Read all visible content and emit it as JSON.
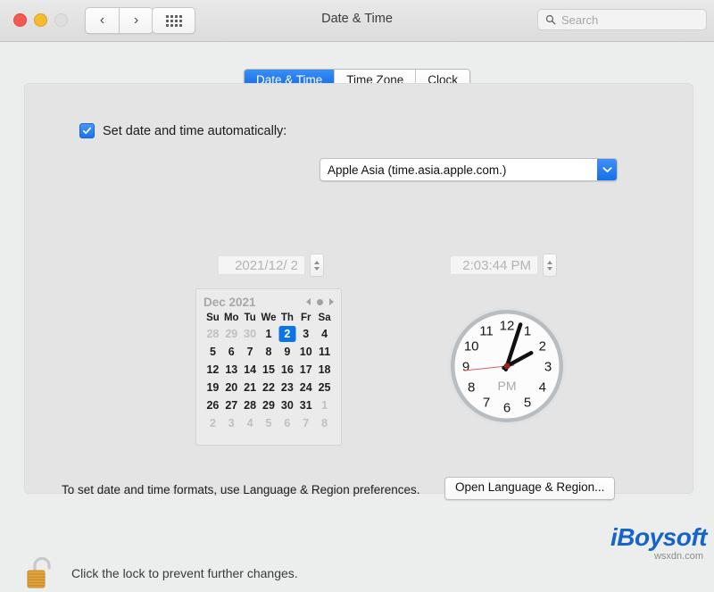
{
  "window": {
    "title": "Date & Time",
    "traffic_lights": [
      "close",
      "minimize",
      "zoom"
    ],
    "back_icon": "chevron-left-icon",
    "forward_icon": "chevron-right-icon",
    "grid_icon": "grid-dots-icon"
  },
  "search": {
    "placeholder": "Search",
    "value": "",
    "icon": "search-icon"
  },
  "tabs": [
    {
      "label": "Date & Time",
      "active": true
    },
    {
      "label": "Time Zone",
      "active": false
    },
    {
      "label": "Clock",
      "active": false
    }
  ],
  "auto_row": {
    "checkbox_checked": true,
    "checkbox_icon": "checkmark-icon",
    "label": "Set date and time automatically:",
    "server_value": "Apple Asia (time.asia.apple.com.)",
    "dropdown_icon": "chevron-down-icon"
  },
  "date_field": {
    "value": "2021/12/ 2",
    "stepper_icon": "stepper-updown-icon"
  },
  "time_field": {
    "value": "2:03:44 PM",
    "stepper_icon": "stepper-updown-icon"
  },
  "calendar": {
    "month_label": "Dec 2021",
    "prev_icon": "triangle-left-icon",
    "today_icon": "dot-icon",
    "next_icon": "triangle-right-icon",
    "day_headers": [
      "Su",
      "Mo",
      "Tu",
      "We",
      "Th",
      "Fr",
      "Sa"
    ],
    "weeks": [
      [
        {
          "d": "28",
          "muted": true
        },
        {
          "d": "29",
          "muted": true
        },
        {
          "d": "30",
          "muted": true
        },
        {
          "d": "1"
        },
        {
          "d": "2",
          "selected": true
        },
        {
          "d": "3"
        },
        {
          "d": "4"
        }
      ],
      [
        {
          "d": "5"
        },
        {
          "d": "6"
        },
        {
          "d": "7"
        },
        {
          "d": "8"
        },
        {
          "d": "9"
        },
        {
          "d": "10"
        },
        {
          "d": "11"
        }
      ],
      [
        {
          "d": "12"
        },
        {
          "d": "13"
        },
        {
          "d": "14"
        },
        {
          "d": "15"
        },
        {
          "d": "16"
        },
        {
          "d": "17"
        },
        {
          "d": "18"
        }
      ],
      [
        {
          "d": "19"
        },
        {
          "d": "20"
        },
        {
          "d": "21"
        },
        {
          "d": "22"
        },
        {
          "d": "23"
        },
        {
          "d": "24"
        },
        {
          "d": "25"
        }
      ],
      [
        {
          "d": "26"
        },
        {
          "d": "27"
        },
        {
          "d": "28"
        },
        {
          "d": "29"
        },
        {
          "d": "30"
        },
        {
          "d": "31"
        },
        {
          "d": "1",
          "muted": true
        }
      ],
      [
        {
          "d": "2",
          "muted": true
        },
        {
          "d": "3",
          "muted": true
        },
        {
          "d": "4",
          "muted": true
        },
        {
          "d": "5",
          "muted": true
        },
        {
          "d": "6",
          "muted": true
        },
        {
          "d": "7",
          "muted": true
        },
        {
          "d": "8",
          "muted": true
        }
      ]
    ]
  },
  "clock": {
    "meridiem": "PM",
    "hour": 2,
    "minute": 3,
    "second": 44,
    "hour_angle": 61.5,
    "minute_angle": 18,
    "second_angle": 264,
    "numerals": [
      "12",
      "1",
      "2",
      "3",
      "4",
      "5",
      "6",
      "7",
      "8",
      "9",
      "10",
      "11"
    ],
    "second_hand_color": "#e06060"
  },
  "format_note": "To set date and time formats, use Language & Region preferences.",
  "open_language_button": "Open Language & Region...",
  "lock": {
    "icon": "unlocked-padlock-icon",
    "message": "Click the lock to prevent further changes."
  },
  "brand": {
    "name": "iBoysoft",
    "sub": "wsxdn.com",
    "color": "#1664c8"
  }
}
